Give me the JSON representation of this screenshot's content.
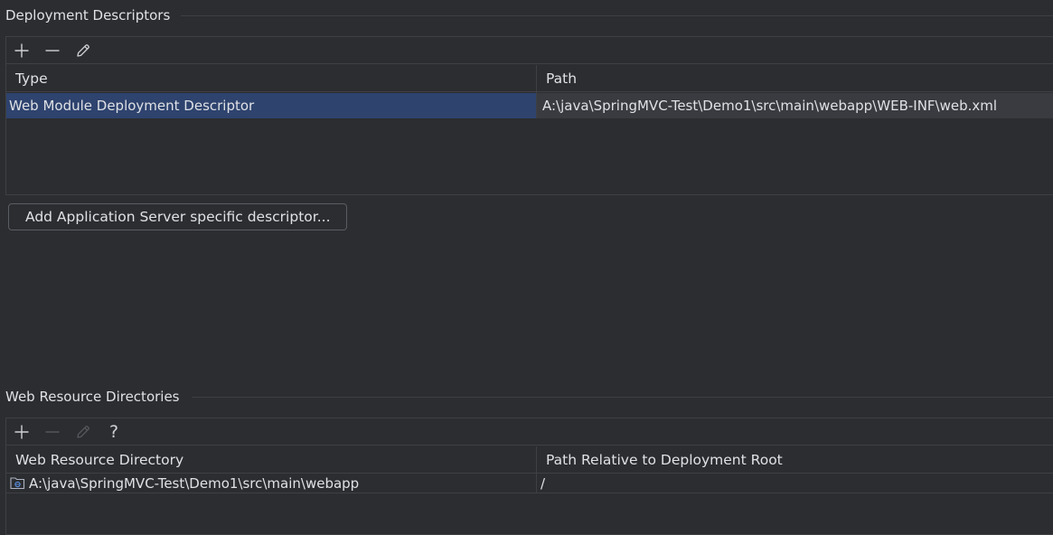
{
  "deployment_descriptors": {
    "title": "Deployment Descriptors",
    "columns": [
      "Type",
      "Path"
    ],
    "rows": [
      {
        "type": "Web Module Deployment Descriptor",
        "path": "A:\\java\\SpringMVC-Test\\Demo1\\src\\main\\webapp\\WEB-INF\\web.xml",
        "selected": true
      }
    ],
    "add_server_descriptor_label": "Add Application Server specific descriptor..."
  },
  "web_resource_directories": {
    "title": "Web Resource Directories",
    "columns": [
      "Web Resource Directory",
      "Path Relative to Deployment Root"
    ],
    "rows": [
      {
        "directory": "A:\\java\\SpringMVC-Test\\Demo1\\src\\main\\webapp",
        "relative_path": "/",
        "icon": "web-folder-icon"
      }
    ],
    "help_label": "?"
  },
  "colors": {
    "background": "#2b2d30",
    "selection": "#2e436e",
    "border": "#3e4043",
    "text": "#dfe1e5",
    "disabled_icon": "#5a5d63"
  }
}
